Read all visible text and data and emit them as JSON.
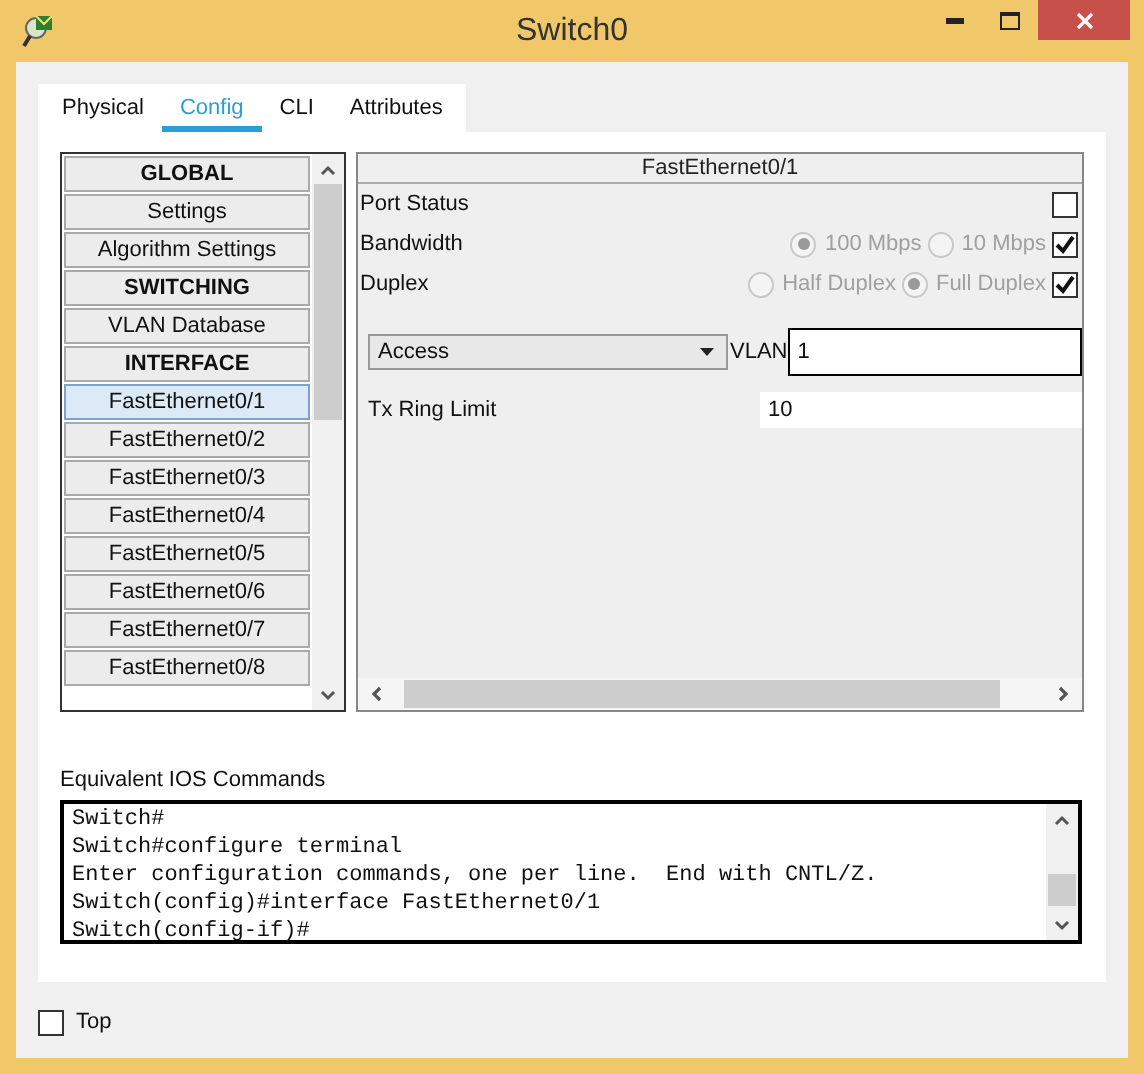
{
  "window": {
    "title": "Switch0"
  },
  "tabs": [
    {
      "label": "Physical",
      "selected": false
    },
    {
      "label": "Config",
      "selected": true
    },
    {
      "label": "CLI",
      "selected": false
    },
    {
      "label": "Attributes",
      "selected": false
    }
  ],
  "sidebar": {
    "items": [
      {
        "label": "GLOBAL",
        "kind": "header",
        "selected": false
      },
      {
        "label": "Settings",
        "kind": "item",
        "selected": false
      },
      {
        "label": "Algorithm Settings",
        "kind": "item",
        "selected": false
      },
      {
        "label": "SWITCHING",
        "kind": "header",
        "selected": false
      },
      {
        "label": "VLAN Database",
        "kind": "item",
        "selected": false
      },
      {
        "label": "INTERFACE",
        "kind": "header",
        "selected": false
      },
      {
        "label": "FastEthernet0/1",
        "kind": "item",
        "selected": true
      },
      {
        "label": "FastEthernet0/2",
        "kind": "item",
        "selected": false
      },
      {
        "label": "FastEthernet0/3",
        "kind": "item",
        "selected": false
      },
      {
        "label": "FastEthernet0/4",
        "kind": "item",
        "selected": false
      },
      {
        "label": "FastEthernet0/5",
        "kind": "item",
        "selected": false
      },
      {
        "label": "FastEthernet0/6",
        "kind": "item",
        "selected": false
      },
      {
        "label": "FastEthernet0/7",
        "kind": "item",
        "selected": false
      },
      {
        "label": "FastEthernet0/8",
        "kind": "item",
        "selected": false
      }
    ]
  },
  "interface": {
    "title": "FastEthernet0/1",
    "port_status": {
      "label": "Port Status",
      "on": false
    },
    "bandwidth": {
      "label": "Bandwidth",
      "auto": true,
      "options": [
        {
          "label": "100 Mbps",
          "selected": true
        },
        {
          "label": "10 Mbps",
          "selected": false
        }
      ]
    },
    "duplex": {
      "label": "Duplex",
      "auto": true,
      "options": [
        {
          "label": "Half Duplex",
          "selected": false
        },
        {
          "label": "Full Duplex",
          "selected": true
        }
      ]
    },
    "mode": {
      "value": "Access"
    },
    "vlan": {
      "label": "VLAN",
      "value": "1"
    },
    "tx_ring_limit": {
      "label": "Tx Ring Limit",
      "value": "10"
    }
  },
  "ios_commands": {
    "label": "Equivalent IOS Commands",
    "lines": [
      "Switch#",
      "Switch#configure terminal",
      "Enter configuration commands, one per line.  End with CNTL/Z.",
      "Switch(config)#interface FastEthernet0/1",
      "Switch(config-if)#"
    ]
  },
  "top": {
    "label": "Top",
    "checked": false
  }
}
